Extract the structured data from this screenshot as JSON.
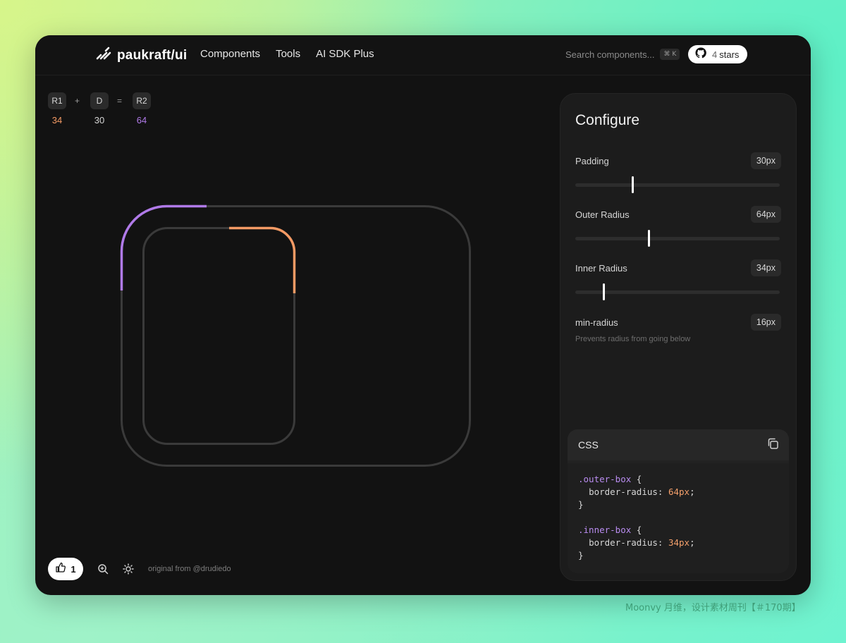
{
  "header": {
    "logo_text": "paukraft/ui",
    "nav": [
      "Components",
      "Tools",
      "AI SDK Plus"
    ],
    "search_placeholder": "Search components...",
    "search_shortcut": "⌘ K",
    "github_count": "4",
    "github_label": "stars"
  },
  "formula": {
    "r1_label": "R1",
    "plus": "+",
    "d_label": "D",
    "equals": "=",
    "r2_label": "R2",
    "r1_value": "34",
    "d_value": "30",
    "r2_value": "64"
  },
  "preview": {
    "outer_color": "#b07ae8",
    "inner_color": "#f39a64",
    "stroke_color": "#3a3a3a"
  },
  "footer": {
    "like_count": "1",
    "credit": "original from @drudiedo"
  },
  "configure": {
    "title": "Configure",
    "controls": [
      {
        "label": "Padding",
        "value": "30px",
        "level": 0.28
      },
      {
        "label": "Outer Radius",
        "value": "64px",
        "level": 0.36
      },
      {
        "label": "Inner Radius",
        "value": "34px",
        "level": 0.14
      }
    ],
    "min_radius": {
      "label": "min-radius",
      "value": "16px",
      "description": "Prevents radius from going below"
    }
  },
  "css_card": {
    "title": "CSS",
    "outer_selector": ".outer-box",
    "inner_selector": ".inner-box",
    "open_brace": "{",
    "close_brace": "}",
    "property": "border-radius:",
    "outer_value": "64px",
    "inner_value": "34px",
    "semicolon": ";"
  },
  "watermark": "Moonvy 月维，设计素材周刊【＃170期】"
}
